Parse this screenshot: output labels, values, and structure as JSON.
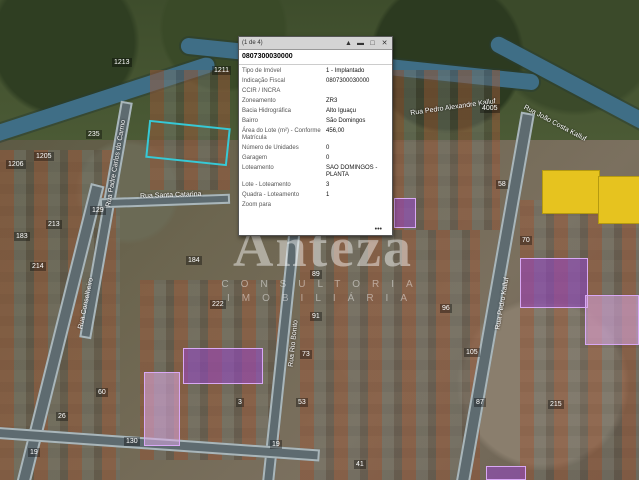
{
  "popup": {
    "counter": "(1 de 4)",
    "id": "0807300030000",
    "rows": [
      {
        "k": "Tipo de Imóvel",
        "v": "1 - Implantado"
      },
      {
        "k": "Indicação Fiscal",
        "v": "0807300030000"
      },
      {
        "k": "CCIR / INCRA",
        "v": ""
      },
      {
        "k": "Zoneamento",
        "v": "ZR3"
      },
      {
        "k": "Bacia Hidrográfica",
        "v": "Alto Iguaçu"
      },
      {
        "k": "Bairro",
        "v": "São Domingos"
      },
      {
        "k": "Área do Lote (m²) - Conforme Matrícula",
        "v": "456,00"
      },
      {
        "k": "Número de Unidades",
        "v": "0"
      },
      {
        "k": "Garagem",
        "v": "0"
      },
      {
        "k": "Loteamento",
        "v": "SAO DOMINGOS - PLANTA"
      },
      {
        "k": "Lote - Loteamento",
        "v": "3"
      },
      {
        "k": "Quadra - Loteamento",
        "v": "1"
      },
      {
        "k": "Zoom para",
        "v": ""
      }
    ],
    "more": "•••",
    "icons": {
      "pin": "pin-icon",
      "minimize": "minimize-icon",
      "maximize": "maximize-icon",
      "close": "close-icon"
    }
  },
  "watermark": {
    "main": "Anteza",
    "sub": "CONSULTORIA IMOBILIÁRIA"
  },
  "streets": {
    "s1": "Rua Pedro Alexandre Kalluf",
    "s2": "Rua João Costa Kalluf",
    "s3": "Rua Padre Carlos do Carmo",
    "s4": "Rua Santa Catarina",
    "s5": "Rua Conselheiro",
    "s6": "Rua Rio Bonito",
    "s7": "Rua Pedro Kalluf"
  },
  "numbers": [
    "1213",
    "1211",
    "1206",
    "1205",
    "235",
    "129",
    "4005",
    "183",
    "184",
    "213",
    "214",
    "222",
    "91",
    "73",
    "53",
    "130",
    "60",
    "26",
    "19",
    "96",
    "105",
    "87",
    "58",
    "70",
    "41",
    "215",
    "19",
    "89",
    "3"
  ],
  "colors": {
    "lot_outline": "#36c9d6",
    "purple": "#9646c8",
    "yellow": "#e6c31f",
    "river": "#3f6e86"
  }
}
